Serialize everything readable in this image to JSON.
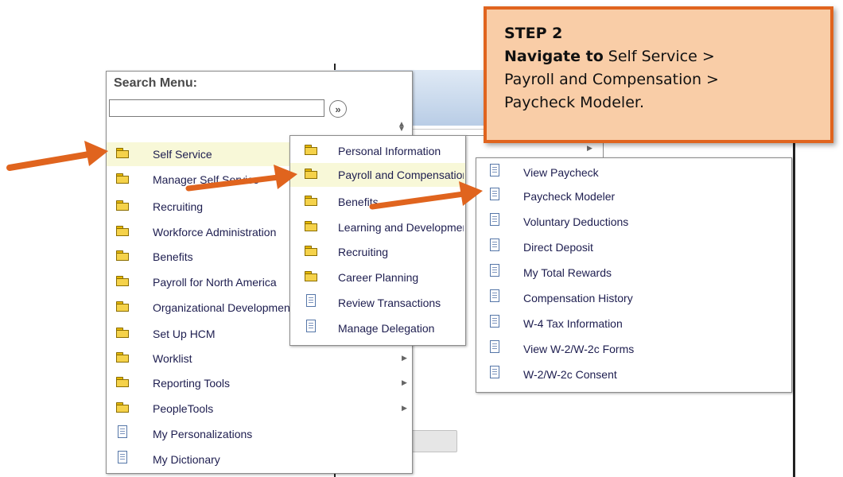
{
  "colors": {
    "accent_arrow": "#e0641e",
    "callout_bg": "#f9cda7",
    "highlight_row": "#f8f8d8",
    "link_text": "#1d1d4f"
  },
  "callout": {
    "step": "STEP 2",
    "nav_label": "Navigate to",
    "path_line1": " Self Service >",
    "path_line2": "Payroll and Compensation >",
    "path_line3": "Paycheck Modeler."
  },
  "menu": {
    "search_label": "Search Menu:",
    "search_value": "",
    "go_icon": "»",
    "items": [
      {
        "label": "Self Service",
        "icon": "folder-icon"
      },
      {
        "label": "Manager Self Service",
        "icon": "folder-icon"
      },
      {
        "label": "Recruiting",
        "icon": "folder-icon"
      },
      {
        "label": "Workforce Administration",
        "icon": "folder-icon"
      },
      {
        "label": "Benefits",
        "icon": "folder-icon"
      },
      {
        "label": "Payroll for North America",
        "icon": "folder-icon"
      },
      {
        "label": "Organizational Development",
        "icon": "folder-icon"
      },
      {
        "label": "Set Up HCM",
        "icon": "folder-icon"
      },
      {
        "label": "Worklist",
        "icon": "folder-icon"
      },
      {
        "label": "Reporting Tools",
        "icon": "folder-icon"
      },
      {
        "label": "PeopleTools",
        "icon": "folder-icon"
      },
      {
        "label": "My Personalizations",
        "icon": "page-icon"
      },
      {
        "label": "My Dictionary",
        "icon": "page-icon"
      }
    ]
  },
  "submenu_self_service": {
    "items": [
      {
        "label": "Personal Information",
        "icon": "folder-icon"
      },
      {
        "label": "Payroll and Compensation",
        "icon": "folder-icon"
      },
      {
        "label": "Benefits",
        "icon": "folder-icon"
      },
      {
        "label": "Learning and Development",
        "icon": "folder-icon"
      },
      {
        "label": "Recruiting",
        "icon": "folder-icon"
      },
      {
        "label": "Career Planning",
        "icon": "folder-icon"
      },
      {
        "label": "Review Transactions",
        "icon": "page-icon"
      },
      {
        "label": "Manage Delegation",
        "icon": "page-icon"
      }
    ]
  },
  "submenu_payroll": {
    "items": [
      {
        "label": "View Paycheck",
        "icon": "page-icon"
      },
      {
        "label": "Paycheck Modeler",
        "icon": "page-icon"
      },
      {
        "label": "Voluntary Deductions",
        "icon": "page-icon"
      },
      {
        "label": "Direct Deposit",
        "icon": "page-icon"
      },
      {
        "label": "My Total Rewards",
        "icon": "page-icon"
      },
      {
        "label": "Compensation History",
        "icon": "page-icon"
      },
      {
        "label": "W-4 Tax Information",
        "icon": "page-icon"
      },
      {
        "label": "View W-2/W-2c Forms",
        "icon": "page-icon"
      },
      {
        "label": "W-2/W-2c Consent",
        "icon": "page-icon"
      }
    ]
  }
}
